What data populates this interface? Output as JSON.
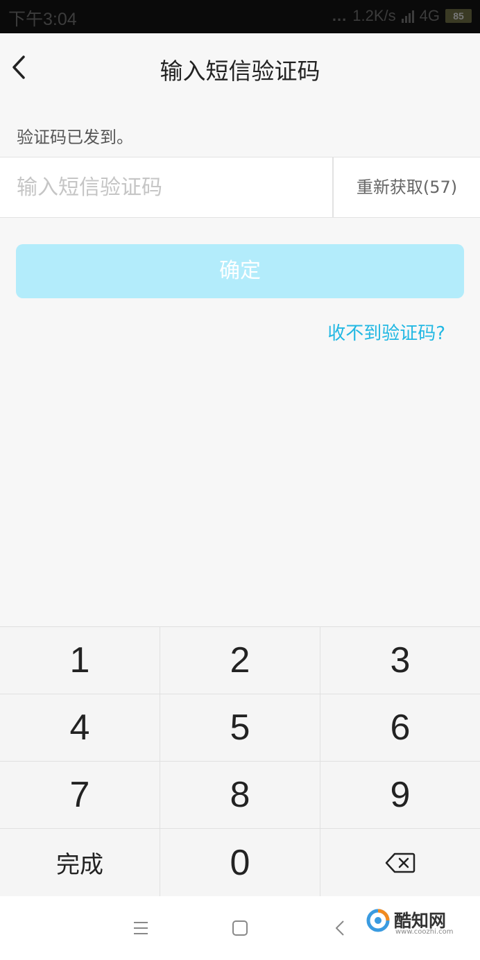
{
  "status_bar": {
    "time": "下午3:04",
    "dots": "...",
    "speed": "1.2K/s",
    "network": "4G",
    "battery": "85"
  },
  "nav": {
    "title": "输入短信验证码"
  },
  "form": {
    "sent_text": "验证码已发到。",
    "code_value": "",
    "code_placeholder": "输入短信验证码",
    "resend_label": "重新获取(57)",
    "confirm_label": "确定",
    "no_code_link": "收不到验证码?"
  },
  "keypad": {
    "keys": [
      "1",
      "2",
      "3",
      "4",
      "5",
      "6",
      "7",
      "8",
      "9",
      "完成",
      "0",
      "backspace-icon"
    ]
  },
  "system_nav": [
    "menu-icon",
    "home-icon",
    "back-icon"
  ],
  "watermark": {
    "name": "酷知网",
    "url": "www.coozhi.com"
  },
  "colors": {
    "accent": "#22b8e3",
    "confirm_disabled": "#b3ecfb",
    "background": "#f7f7f7"
  }
}
